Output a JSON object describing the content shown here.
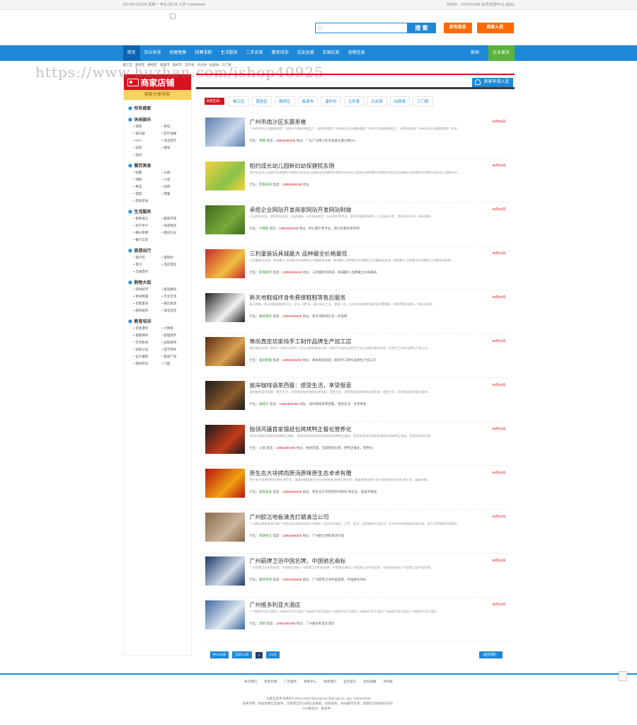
{
  "topbar": {
    "date": "2021年7月19日 星期一 丰云 [东] 年 六月十undefined",
    "user": "欢迎你：1102241939 [会员管理中心] [退出]"
  },
  "search": {
    "placeholder": "",
    "button": "搜 索"
  },
  "header_buttons": {
    "publish": "发布信息",
    "join": "商家入驻"
  },
  "nav": {
    "items": [
      "首页",
      "百业供求",
      "房屋租售",
      "招聘求职",
      "生活服务",
      "二手买卖",
      "教育培训",
      "交友征婚",
      "车辆买卖",
      "宠物信息"
    ],
    "right": [
      "新闻",
      "企业黄页"
    ]
  },
  "subnav": [
    "椒江区",
    "黄岩区",
    "路桥区",
    "临海市",
    "温岭市",
    "玉环县",
    "天台县",
    "仙居县",
    "三门县"
  ],
  "watermark": "https://www.huzhan.com/ishop40925",
  "sidebar": {
    "title": "商家店铺",
    "subtitle": "商家分类导航",
    "all": "所有商家",
    "categories": [
      {
        "name": "休闲娱乐",
        "items": [
          "酒吧",
          "茶馆",
          "俱乐部",
          "足疗按摩",
          "KTV",
          "洗浴足疗",
          "美容",
          "健身",
          "运动"
        ]
      },
      {
        "name": "餐饮美食",
        "items": [
          "快餐",
          "火锅",
          "海鲜",
          "川菜",
          "粤菜",
          "烧烤",
          "蛋糕",
          "西餐",
          "其他美食"
        ]
      },
      {
        "name": "生活服务",
        "items": [
          "家政保洁",
          "搬家开锁",
          "房产中介",
          "快递物流",
          "婚纱影楼",
          "婚庆礼仪",
          "婚介交友"
        ]
      },
      {
        "name": "旅游出行",
        "items": [
          "旅行社",
          "度假村",
          "景点",
          "酒店宾馆",
          "交通票务"
        ]
      },
      {
        "name": "购物大街",
        "items": [
          "商场超市",
          "家电数码",
          "休闲鞋服",
          "文化艺术",
          "母婴童装",
          "箱包家具",
          "服装服饰",
          "珠宝首饰"
        ]
      },
      {
        "name": "教育培训",
        "items": [
          "无香港印",
          "IT网络",
          "家教辅导",
          "管理财务",
          "艺术影视",
          "远程教育",
          "技能认证",
          "留学移民",
          "设计摄影",
          "家居广场",
          "建材市场",
          "门窗"
        ]
      }
    ]
  },
  "content": {
    "apply": "商家申请入驻",
    "region_label": "商家区域：",
    "regions": [
      "椒江区",
      "黄岩区",
      "路桥区",
      "临海市",
      "温岭市",
      "玉环县",
      "天台县",
      "仙居县",
      "三门县"
    ],
    "items": [
      {
        "title": "广州市南沙区东震茶楼",
        "date": "09月08日",
        "desc": "广州市南沙区东震茶楼是广州南沙片最具茶楼品广，经营茶楼和广州市南沙区东震茶楼是广州南沙片最具茶楼品广，经营茶楼和广州市南沙区东震茶楼是广州南...",
        "industry": "茶楼",
        "tel": "13852865268",
        "addr": "广东广州南沙区开发路东震大楼001"
      },
      {
        "title": "稻约成长幼儿园新妇幼保健院东侧",
        "date": "08月30日",
        "desc": "稻约成长幼儿园新妇幼保健院东侧稻约成长幼儿园新妇幼保健院东侧稻约成长幼儿园新妇幼保健院东侧稻约成长幼儿园新妇幼保健院东侧稻约成长幼儿园新妇幼...",
        "industry": "无限培训",
        "tel": "13852865268",
        "addr": ""
      },
      {
        "title": "承揽企业网站开发商家网站开发网站制做",
        "date": "08月30日",
        "desc": "企业网站开发，商家网站开发，网站制做，十年建站经验，所以我们更专业，我们的服务更周到。企业网站开发，商家网站开发，网站制做...",
        "industry": "IT网络",
        "tel": "13852865268",
        "addr": "所以我们更专业，我们的服务更周到"
      },
      {
        "title": "三利童装玩具城最大 品种最全价格最低",
        "date": "08月30日",
        "desc": "三利童装玩具城，梅城最大 品种最全价格最低三利童装玩具城，梅城最大 品种最全价格最低三利童装玩具城，梅城最大 品种最全价格最低三利童装玩具城...",
        "industry": "商场超市",
        "tel": "13852865268",
        "addr": "三利童装玩具城，梅城最大 品种最全价格最低"
      },
      {
        "title": "新天地鞋城终身免费擦鞋鞋等售后服务",
        "date": "08月30日",
        "desc": "新天地鞋，新天地鞋城鞋底开业，全场一律7折，要从新开三天，赠送一双，凡在本店购物的鞋终身免费擦鞋、修鞋等售后服务，凭新天地鞋...",
        "industry": "服装服饰",
        "tel": "13852865268",
        "addr": "新天地鞋城在有一折送鞋"
      },
      {
        "title": "尊尚真皮坊家纯手工制作品牌生产加工店",
        "date": "08月30日",
        "desc": "尊尚真皮坊是一家纯手工制作品牌生产加工店尊尚真皮坊是一家纯手工制作品牌生产加工店尊尚真皮坊是一家纯手工制作品牌生产加工店...",
        "industry": "服装鞋服",
        "tel": "13852865268",
        "addr": "尊尚真皮坊是一家纯手工制作品牌生产加工店"
      },
      {
        "title": "彼岸咖啡语茶西餐：感受生活，享受惬意",
        "date": "08月30日",
        "desc": "彼岸咖啡语茶西餐：感受生活、享受惬意彼岸咖啡语茶西餐：感受生活、享受惬意彼岸咖啡语茶西餐：感受生活、享受惬意彼岸咖啡语茶...",
        "industry": "咖啡厅",
        "tel": "13852865268",
        "addr": "彼岸咖啡语茶西餐，感受生活、享受惬意"
      },
      {
        "title": "独领风骚首家锡纸包烤烤鸭正餐化营养化",
        "date": "08月30日",
        "desc": "独领风骚首家锡纸包烤烤鸭正餐化、营养化独领风骚首家锡纸包烤烤鸭正餐化、营养化独领风骚首家锡纸包烤烤鸭正餐化、营养化独领风骚...",
        "industry": "火锅",
        "tel": "13852865268",
        "addr": "独领风骚，首家锡纸包烤，烤鸭正餐化，营养化"
      },
      {
        "title": "原生态大块拷肉原汤原味原生态卓卓有赠",
        "date": "08月30日",
        "desc": "原生态大块拷肉原汤原味 原生态，桌桌有赠送原生态大块拷肉原汤原味 原生态，桌桌有赠送原生态大块拷肉原汤原味 原生态，桌桌有赠...",
        "industry": "其他美食",
        "tel": "13852865268",
        "addr": "原生态大块拷肉原汤原味 原生态，桌桌有赠送"
      },
      {
        "title": "广州欧洁地板清洗打蜡清洁公司",
        "date": "08月30日",
        "desc": "广州欧洁地板清洗打蜡广州欧洁清洁服务有限公司拥有一支庞大的遍洁、开荒、保洁、清洗服务专业队伍，无论何时何地来电咨询洽谈，本公司将竭诚为您服务...",
        "industry": "家政保洁",
        "tel": "13852865268",
        "addr": "广州欧洁地板清洗打蜡"
      },
      {
        "title": "广州箭牌卫浴中国名牌，中国驰名商标",
        "date": "08月30日",
        "desc": "广州箭牌卫浴中国名牌，中国驰名商标广州箭牌卫浴中国名牌，中国驰名商标广州箭牌卫浴中国名牌，中国驰名商标广州箭牌卫浴中国名牌...",
        "industry": "建材市场",
        "tel": "13852865268",
        "addr": "广州箭牌卫浴中国名牌，中国驰名商标"
      },
      {
        "title": "广州维多利亚大酒店",
        "date": "08月29日",
        "desc": "广州维多利亚大酒店广州维多利亚大酒店广州维多利亚大酒店广州维多利亚大酒店广州维多利亚大酒店广州维多利亚大酒店广州维多利亚大酒店...",
        "industry": "酒吧",
        "tel": "13852865268",
        "addr": "广州维多利亚大酒店"
      }
    ],
    "industry_label": "行业：",
    "tel_label": "电话：",
    "addr_label": "地址：",
    "pager": {
      "total": "共12记录",
      "pages": "当前1/1页",
      "current": "1",
      "all": "1/1页",
      "top": "返回顶部 ↑"
    }
  },
  "footer": {
    "links": [
      "关于我们",
      "免责声明",
      "广告服务",
      "帮助中心",
      "联系我们",
      "设为首页",
      "加为收藏",
      "手机版"
    ],
    "line1": "分类信息平台演示© 2014-2020 http://simsi.nfaile.xip lnc. QQ: 1102241939",
    "line2": "法律声明：本站免费信息发布，交易者自行分辨信息真假，如有损失，本站概不负责，谢谢您对本站的支持！",
    "line3": "ICP备案号：备案中...."
  }
}
